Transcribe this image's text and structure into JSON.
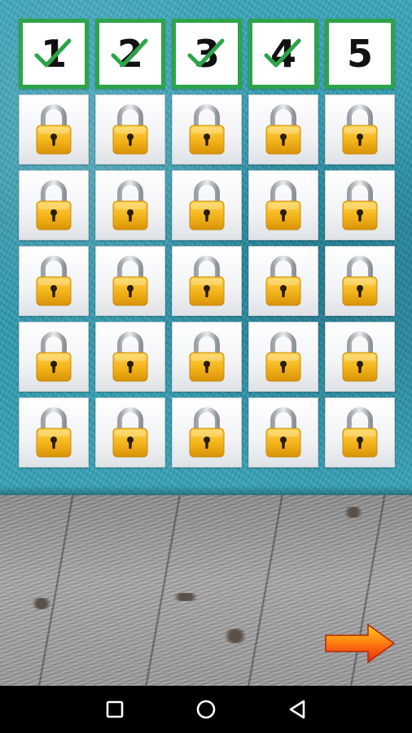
{
  "levels": [
    {
      "label": "1",
      "completed": true
    },
    {
      "label": "2",
      "completed": true
    },
    {
      "label": "3",
      "completed": true
    },
    {
      "label": "4",
      "completed": true
    },
    {
      "label": "5",
      "completed": false
    }
  ],
  "locked_rows": 5,
  "locked_cols": 5,
  "icons": {
    "check": "checkmark-icon",
    "lock": "padlock-icon",
    "next": "right-arrow-icon",
    "recents": "square-icon",
    "home": "circle-icon",
    "back": "triangle-back-icon"
  },
  "colors": {
    "level_border": "#2da44a",
    "check": "#2da44a",
    "wall": "#2d97ac",
    "lock": "#f2b319",
    "arrow": "#f04a10"
  }
}
